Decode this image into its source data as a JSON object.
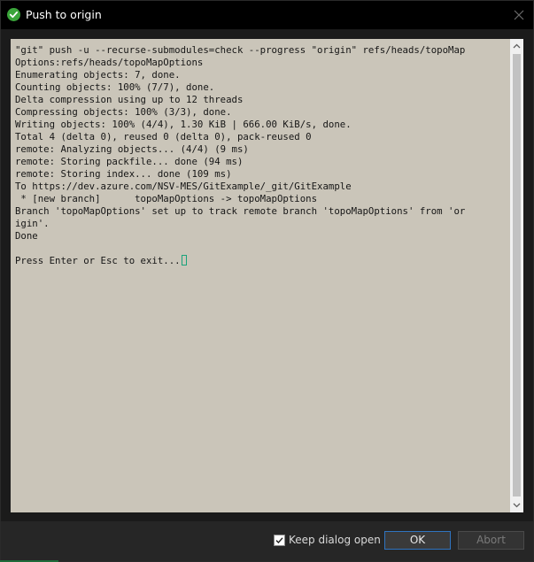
{
  "window": {
    "title": "Push to origin",
    "icon": "success-check-icon",
    "accent_color": "#3aa53a"
  },
  "console": {
    "background_color": "#cac5b9",
    "lines": [
      "\"git\" push -u --recurse-submodules=check --progress \"origin\" refs/heads/topoMap",
      "Options:refs/heads/topoMapOptions",
      "Enumerating objects: 7, done.",
      "Counting objects: 100% (7/7), done.",
      "Delta compression using up to 12 threads",
      "Compressing objects: 100% (3/3), done.",
      "Writing objects: 100% (4/4), 1.30 KiB | 666.00 KiB/s, done.",
      "Total 4 (delta 0), reused 0 (delta 0), pack-reused 0",
      "remote: Analyzing objects... (4/4) (9 ms)",
      "remote: Storing packfile... done (94 ms)",
      "remote: Storing index... done (109 ms)",
      "To https://dev.azure.com/NSV-MES/GitExample/_git/GitExample",
      " * [new branch]      topoMapOptions -> topoMapOptions",
      "Branch 'topoMapOptions' set up to track remote branch 'topoMapOptions' from 'or",
      "igin'.",
      "Done",
      "",
      "Press Enter or Esc to exit..."
    ]
  },
  "footer": {
    "keep_open_label": "Keep dialog open",
    "keep_open_checked": true,
    "ok_label": "OK",
    "abort_label": "Abort",
    "abort_enabled": false
  }
}
